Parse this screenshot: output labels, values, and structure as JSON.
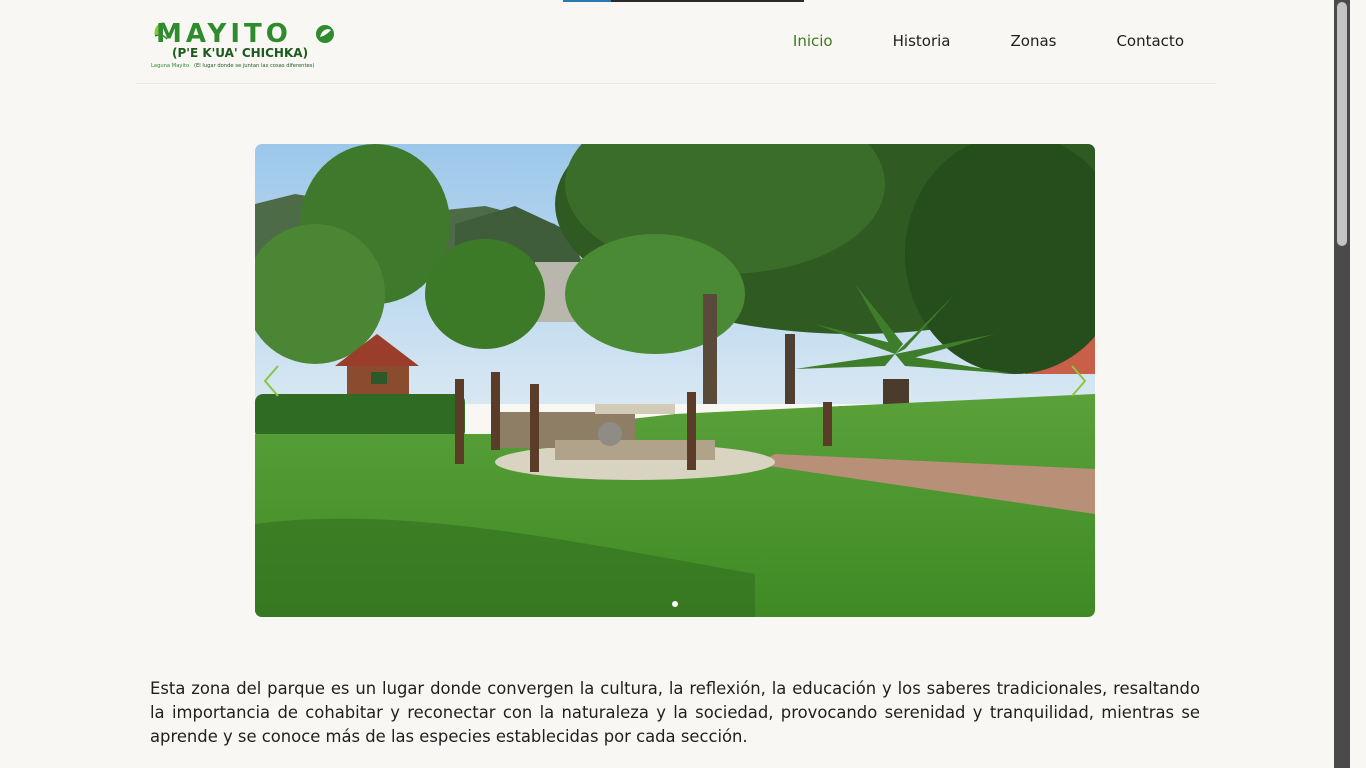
{
  "header": {
    "logo": {
      "title": "MAYITO",
      "subtitle": "(P'E K'UA' CHICHKA)",
      "tagline_prefix": "Laguna Mayito",
      "tagline": "(El lugar donde se juntan las cosas diferentes)"
    },
    "nav": [
      {
        "label": "Inicio",
        "active": true
      },
      {
        "label": "Historia",
        "active": false
      },
      {
        "label": "Zonas",
        "active": false
      },
      {
        "label": "Contacto",
        "active": false
      }
    ]
  },
  "slider": {
    "image_icon": "park-garden-photo",
    "prev_icon": "chevron-left-icon",
    "next_icon": "chevron-right-icon",
    "slide_count": 1,
    "active_slide": 1
  },
  "intro": {
    "text": "Esta zona del parque es un lugar donde convergen  la cultura, la reflexión, la educación  y los saberes tradicionales, resaltando la importancia de cohabitar y reconectar con la naturaleza y la sociedad, provocando serenidad y tranquilidad, mientras se aprende y se conoce más de las especies establecidas por cada sección."
  },
  "loading": {
    "progress": 0.2
  },
  "colors": {
    "background": "#f8f7f3",
    "nav_active": "#3d7a1e",
    "logo_green": "#2e8b2e",
    "logo_dark": "#1d5a1d",
    "logo_lime": "#8cc63f"
  }
}
